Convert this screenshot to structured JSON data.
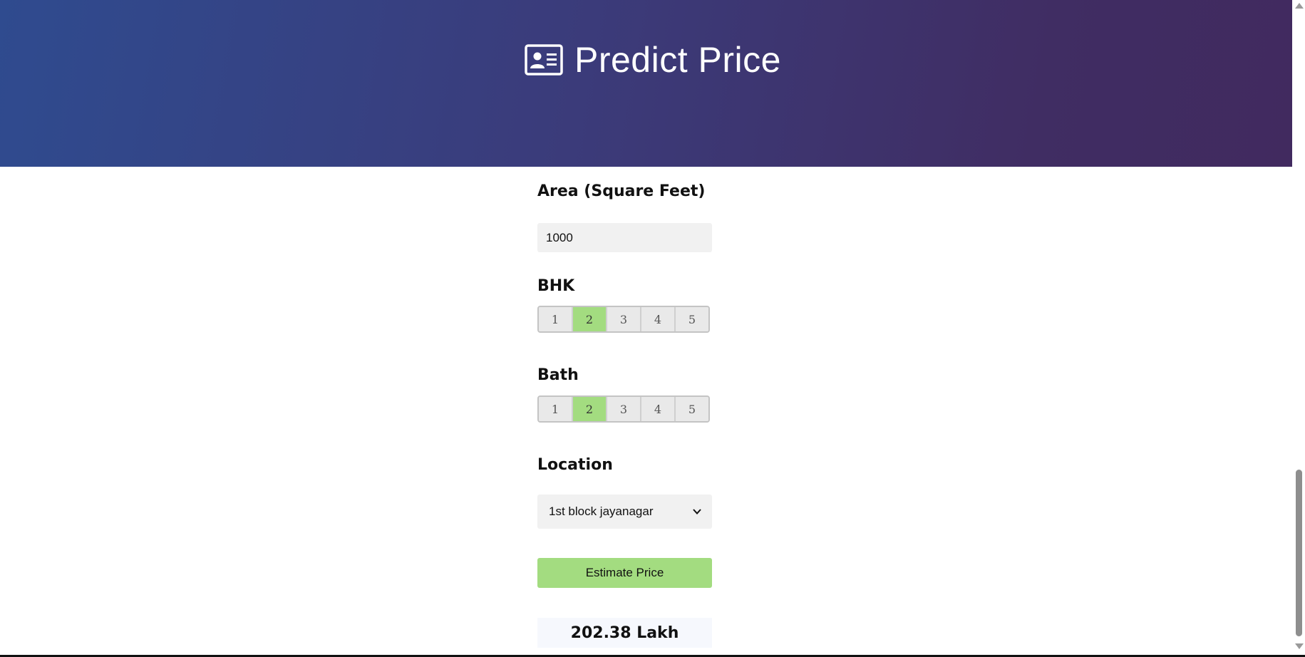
{
  "header": {
    "title": "Predict Price",
    "icon": "id-card-icon"
  },
  "area": {
    "label": "Area (Square Feet)",
    "value": "1000"
  },
  "bhk": {
    "label": "BHK",
    "options": [
      "1",
      "2",
      "3",
      "4",
      "5"
    ],
    "selected": "2"
  },
  "bath": {
    "label": "Bath",
    "options": [
      "1",
      "2",
      "3",
      "4",
      "5"
    ],
    "selected": "2"
  },
  "location": {
    "label": "Location",
    "selected": "1st block jayanagar"
  },
  "estimate_button": {
    "label": "Estimate Price"
  },
  "result": {
    "text": "202.38 Lakh"
  },
  "colors": {
    "accent_green": "#a3dc80",
    "header_gradient_start": "#2f4b8f",
    "header_gradient_end": "#412a5f"
  }
}
